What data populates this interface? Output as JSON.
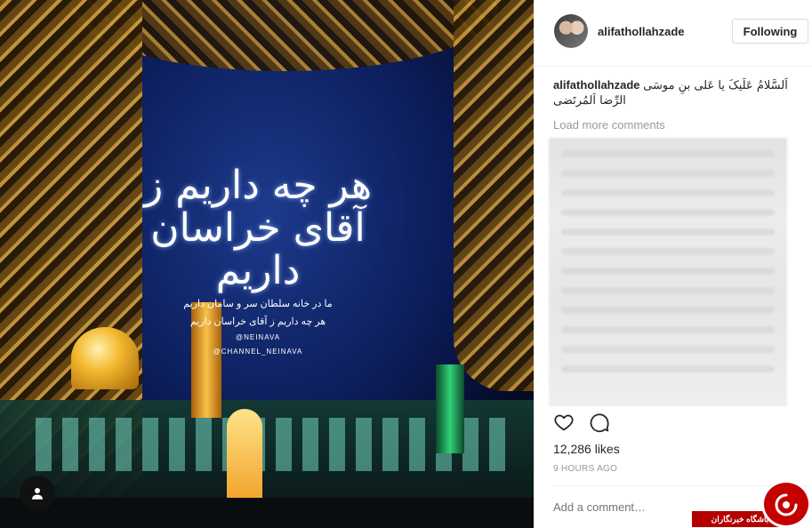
{
  "post": {
    "photo": {
      "calligraphy_main": "هر چه داریم ز آقای خراسان داریم",
      "calligraphy_sub_1": "ما در خانه سلطان سر و سامان داریم",
      "calligraphy_sub_2": "هر چه داریم ز آقای خراسان داریم",
      "handle_1": "@NEINAVA",
      "handle_2": "@CHANNEL_NEINAVA"
    },
    "header": {
      "username": "alifathollahzade",
      "follow_label": "Following"
    },
    "caption": {
      "username": "alifathollahzade",
      "text": "اَلسَّلامُ عَلَیکَ یا عَلی بنِ موسَی الرِّضا اَلمُرتَضی"
    },
    "load_more_label": "Load more comments",
    "likes": "12,286 likes",
    "time": "9 HOURS AGO",
    "comment_placeholder": "Add a comment…",
    "icons": [
      "heart-icon",
      "comment-icon",
      "user-tag-icon"
    ]
  },
  "watermark": {
    "text": "باشگاه خبرنگاران",
    "color": "#c40000"
  }
}
